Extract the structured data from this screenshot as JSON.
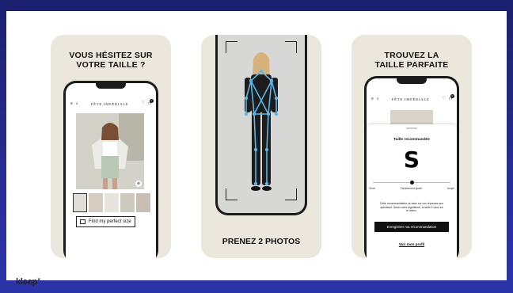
{
  "panel1": {
    "headline_line1": "VOUS HÉSITEZ SUR",
    "headline_line2": "VOTRE TAILLE ?",
    "brand": "FÊTE IMPÉRIALE",
    "cart_count": "0",
    "find_size_label": "Find my perfect size"
  },
  "panel2": {
    "caption": "PRENEZ 2 PHOTOS"
  },
  "panel3": {
    "headline_line1": "TROUVEZ LA",
    "headline_line2": "TAILLE PARFAITE",
    "brand": "FÊTE IMPÉRIALE",
    "cart_count": "0",
    "recommended_label": "Taille recommandée",
    "recommended_size": "S",
    "fit_position": 0.5,
    "fit_labels": [
      "Serré",
      "Parfaitement ajusté",
      "Ample"
    ],
    "recommendation_text": "Cette recommandation se base sur vos réponses aux questions. Selon notre algorithme, la taille S vous ira le mieux.",
    "save_button_label": "Enregistrer ma recommandation",
    "profile_link_label": "Voir mon profil"
  },
  "footer": {
    "logo_text": "kleep"
  },
  "colors": {
    "background_gradient_top": "#1a1f6e",
    "background_gradient_bottom": "#2b35a8",
    "card_beige": "#ece7dd",
    "skeleton_blue": "#5fb4e6"
  }
}
